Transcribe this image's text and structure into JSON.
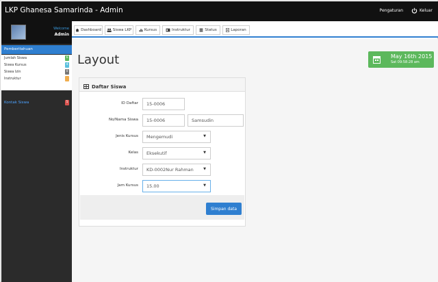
{
  "app": {
    "title": "LKP Ghanesa Samarinda - Admin",
    "settings_label": "Pengaturan",
    "logout_label": "Keluar"
  },
  "user": {
    "welcome": "Welcome",
    "name": "Admin"
  },
  "sidebar": {
    "header": "Pemberitahuan",
    "items": [
      {
        "label": "Jumlah Siswa",
        "color": "#5cb85c"
      },
      {
        "label": "Siswa Kursus",
        "color": "#5bc0de"
      },
      {
        "label": "Siswa Izin",
        "color": "#777777"
      },
      {
        "label": "Instruktur",
        "color": "#f0ad4e"
      }
    ],
    "contact_label": "Kontak Siswa",
    "contact_color": "#d9534f"
  },
  "tabs": [
    {
      "label": "Dashboard",
      "icon": "home-icon"
    },
    {
      "label": "Siswa LKP",
      "icon": "users-icon"
    },
    {
      "label": "Kursus",
      "icon": "chart-icon"
    },
    {
      "label": "Instruktur",
      "icon": "id-card-icon"
    },
    {
      "label": "Status",
      "icon": "list-icon"
    },
    {
      "label": "Laporan",
      "icon": "document-icon"
    }
  ],
  "page": {
    "title": "Layout",
    "date": "May 16th 2015",
    "time": "Sat 09:58:28 am"
  },
  "form": {
    "title": "Daftar Siswa",
    "fields": {
      "id_daftar": {
        "label": "ID Daftar",
        "value": "15-0006"
      },
      "no_nama": {
        "label": "No/Nama Siswa",
        "value_no": "15-0006",
        "value_nama": "Samsudin"
      },
      "jenis_kursus": {
        "label": "Jenis Kursus",
        "value": "Mengemudi"
      },
      "kelas": {
        "label": "Kelas",
        "value": "Eksekutif"
      },
      "instruktur": {
        "label": "Instruktur",
        "value": "KD-0002Nur Rahman"
      },
      "jam_kursus": {
        "label": "Jam Kursus",
        "value": "15.00"
      }
    },
    "save_label": "Simpan data"
  },
  "colors": {
    "accent": "#2f7fd0",
    "date_box": "#5cb85c",
    "topbar": "#111111",
    "sidebar": "#2b2b2b"
  }
}
